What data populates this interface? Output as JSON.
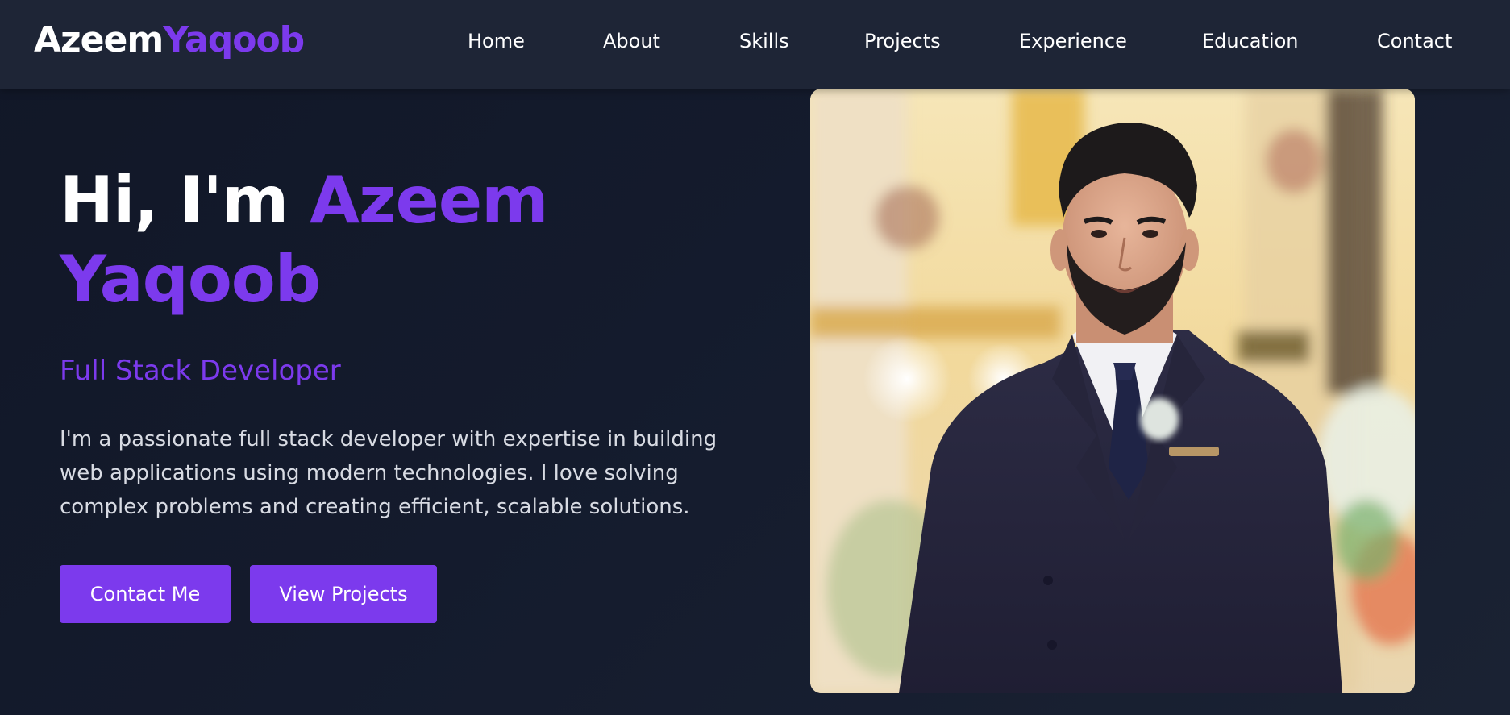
{
  "header": {
    "logo_first": "Azeem",
    "logo_last": "Yaqoob",
    "nav": [
      {
        "label": "Home"
      },
      {
        "label": "About"
      },
      {
        "label": "Skills"
      },
      {
        "label": "Projects"
      },
      {
        "label": "Experience"
      },
      {
        "label": "Education"
      },
      {
        "label": "Contact"
      }
    ]
  },
  "hero": {
    "greeting": "Hi, I'm",
    "name_first": "Azeem",
    "name_last": "Yaqoob",
    "role": "Full Stack Developer",
    "description": "I'm a passionate full stack developer with expertise in building web applications using modern technologies. I love solving complex problems and creating efficient, scalable solutions.",
    "buttons": {
      "contact": "Contact Me",
      "projects": "View Projects"
    }
  },
  "colors": {
    "accent": "#7c3aed",
    "background": "#131a2c",
    "navbar": "#1e2536",
    "text": "#ffffff"
  },
  "photo": {
    "icon": "profile-photo"
  }
}
